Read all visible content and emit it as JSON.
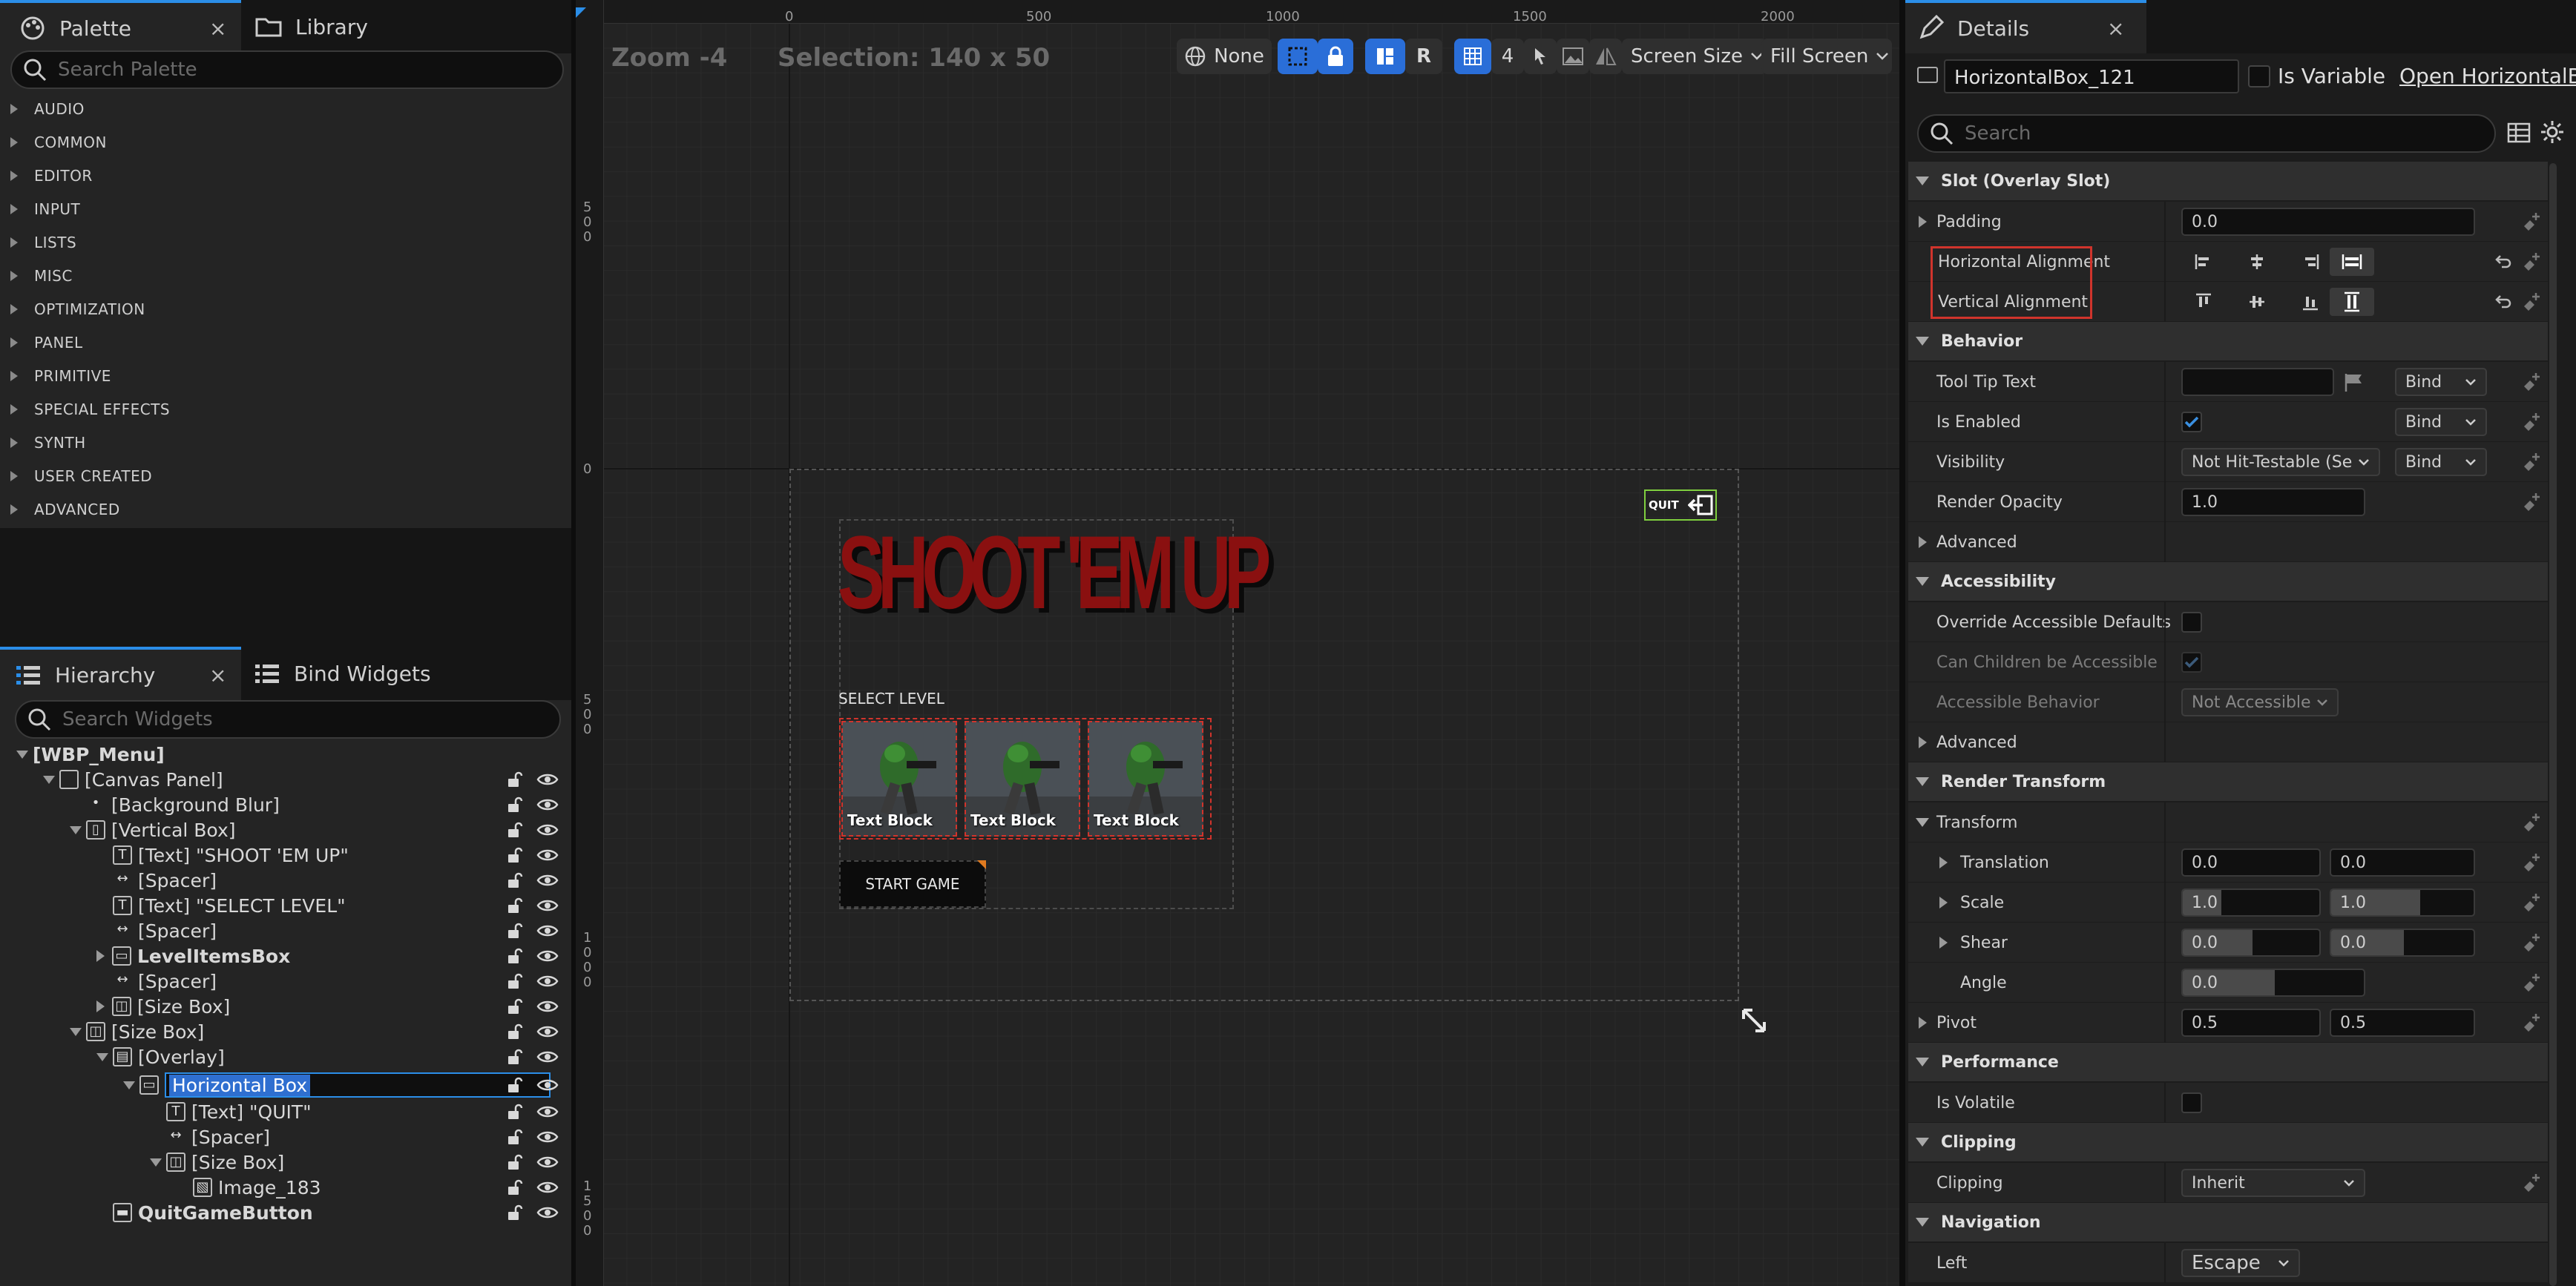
{
  "palette": {
    "tab_label": "Palette",
    "close": "×",
    "search_placeholder": "Search Palette",
    "categories": [
      "AUDIO",
      "COMMON",
      "EDITOR",
      "INPUT",
      "LISTS",
      "MISC",
      "OPTIMIZATION",
      "PANEL",
      "PRIMITIVE",
      "SPECIAL EFFECTS",
      "SYNTH",
      "USER CREATED",
      "ADVANCED"
    ]
  },
  "library": {
    "tab_label": "Library"
  },
  "hierarchy": {
    "tab_label": "Hierarchy",
    "close": "×",
    "bind_tab_label": "Bind Widgets",
    "search_placeholder": "Search Widgets",
    "items": [
      {
        "label": "[WBP_Menu]",
        "icon": "root"
      },
      {
        "label": "[Canvas Panel]",
        "icon": "canvas-icon"
      },
      {
        "label": "[Background Blur]",
        "icon": "dot-icon"
      },
      {
        "label": "[Vertical Box]",
        "icon": "vertical-box-icon"
      },
      {
        "label": "[Text] \"SHOOT 'EM UP\"",
        "icon": "text-icon"
      },
      {
        "label": "[Spacer]",
        "icon": "spacer-icon"
      },
      {
        "label": "[Text] \"SELECT LEVEL\"",
        "icon": "text-icon"
      },
      {
        "label": "[Spacer]",
        "icon": "spacer-icon"
      },
      {
        "label": "LevelItemsBox",
        "icon": "horizontal-box-icon"
      },
      {
        "label": "[Spacer]",
        "icon": "spacer-icon"
      },
      {
        "label": "[Size Box]",
        "icon": "size-box-icon"
      },
      {
        "label": "[Size Box]",
        "icon": "size-box-icon"
      },
      {
        "label": "[Overlay]",
        "icon": "overlay-icon"
      },
      {
        "label": "Horizontal Box",
        "icon": "horizontal-box-icon"
      },
      {
        "label": "[Text] \"QUIT\"",
        "icon": "text-icon"
      },
      {
        "label": "[Spacer]",
        "icon": "spacer-icon"
      },
      {
        "label": "[Size Box]",
        "icon": "size-box-icon"
      },
      {
        "label": "Image_183",
        "icon": "image-icon"
      },
      {
        "label": "QuitGameButton",
        "icon": "button-icon"
      }
    ]
  },
  "viewport": {
    "zoom": "Zoom -4",
    "selection": "Selection: 140 x 50",
    "toolbar": {
      "none_label": "None",
      "r_label": "R",
      "grid_value": "4",
      "screen_size": "Screen Size",
      "fill_screen": "Fill Screen"
    },
    "ruler_top": [
      "0",
      "500",
      "1000",
      "1500",
      "2000"
    ],
    "ruler_left": [
      "500",
      "0",
      "500",
      "1000",
      "1500"
    ],
    "canvas": {
      "title": "SHOOT 'EM UP",
      "select_level": "SELECT LEVEL",
      "level_items": [
        "Text Block",
        "Text Block",
        "Text Block"
      ],
      "start_game": "START GAME",
      "quit": "QUIT"
    }
  },
  "details": {
    "tab_label": "Details",
    "close": "×",
    "widget_name": "HorizontalBox_121",
    "is_variable": "Is Variable",
    "open_link": "Open HorizontalBo",
    "search_placeholder": "Search",
    "sections": {
      "slot": "Slot (Overlay Slot)",
      "behavior": "Behavior",
      "accessibility": "Accessibility",
      "render_transform": "Render Transform",
      "transform": "Transform",
      "performance": "Performance",
      "clipping": "Clipping",
      "navigation": "Navigation"
    },
    "props": {
      "padding": {
        "label": "Padding",
        "value": "0.0"
      },
      "h_align": {
        "label": "Horizontal Alignment"
      },
      "v_align": {
        "label": "Vertical Alignment"
      },
      "tooltip": {
        "label": "Tool Tip Text",
        "bind": "Bind"
      },
      "is_enabled": {
        "label": "Is Enabled",
        "bind": "Bind"
      },
      "visibility": {
        "label": "Visibility",
        "value": "Not Hit-Testable (Se",
        "bind": "Bind"
      },
      "render_opacity": {
        "label": "Render Opacity",
        "value": "1.0"
      },
      "advanced": {
        "label": "Advanced"
      },
      "override_access": {
        "label": "Override Accessible Defaults"
      },
      "can_children": {
        "label": "Can Children be Accessible"
      },
      "access_behavior": {
        "label": "Accessible Behavior",
        "value": "Not Accessible"
      },
      "advanced2": {
        "label": "Advanced"
      },
      "translation": {
        "label": "Translation",
        "x": "0.0",
        "y": "0.0"
      },
      "scale": {
        "label": "Scale",
        "x": "1.0",
        "y": "1.0"
      },
      "shear": {
        "label": "Shear",
        "x": "0.0",
        "y": "0.0"
      },
      "angle": {
        "label": "Angle",
        "value": "0.0"
      },
      "pivot": {
        "label": "Pivot",
        "x": "0.5",
        "y": "0.5"
      },
      "is_volatile": {
        "label": "Is Volatile"
      },
      "clipping": {
        "label": "Clipping",
        "value": "Inherit"
      },
      "nav_left": {
        "label": "Left",
        "value": "Escape"
      }
    }
  },
  "colors": {
    "accent": "#2b8ee8",
    "highlight_box": "#d0342c",
    "title_red": "#8a1010",
    "checkbox_blue": "#3a8fe0",
    "selection_green": "#7fcf3f"
  }
}
